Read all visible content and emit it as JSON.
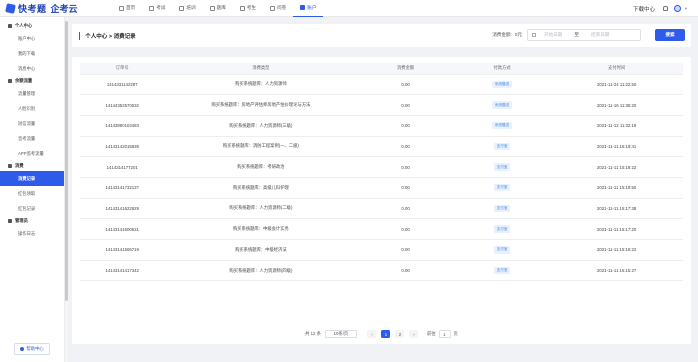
{
  "brand": {
    "name": "快考题",
    "sub": "企考云"
  },
  "nav": [
    {
      "label": "首页",
      "icon": "home-icon"
    },
    {
      "label": "考试",
      "icon": "exam-icon"
    },
    {
      "label": "培训",
      "icon": "training-icon"
    },
    {
      "label": "题库",
      "icon": "question-bank-icon"
    },
    {
      "label": "考生",
      "icon": "examinee-icon"
    },
    {
      "label": "问卷",
      "icon": "survey-icon"
    },
    {
      "label": "账户",
      "icon": "account-icon",
      "active": true
    }
  ],
  "topright": {
    "download": "下载中心"
  },
  "sidebar": {
    "groups": [
      {
        "title": "个人中心",
        "items": [
          "账户中心",
          "我的下载",
          "消息中心"
        ]
      },
      {
        "title": "余额流量",
        "items": [
          "流量管理",
          "人脸识别",
          "短信流量",
          "音考流量",
          "APP监考流量"
        ]
      },
      {
        "title": "消费",
        "items": [
          "消费记录",
          "红包领取",
          "红包记录"
        ]
      },
      {
        "title": "管理员",
        "items": [
          "操作日志"
        ]
      }
    ],
    "active": "消费记录",
    "help": "帮助中心"
  },
  "header": {
    "breadcrumb": "个人中心 > 消费记录",
    "amount_label": "消费金额:",
    "amount_value": "0元",
    "start_placeholder": "开始日期",
    "to": "至",
    "end_placeholder": "结束日期",
    "search": "搜索"
  },
  "table": {
    "columns": [
      "订单号",
      "消费类型",
      "消费金额",
      "付款方式",
      "支付时间"
    ],
    "rows": [
      [
        "1414331142287",
        "购买系统题库：人力资源师",
        "0.00",
        "系统赠送",
        "2021-11-24 11:22:50"
      ],
      [
        "14144352570632",
        "购买系统题库：房地产评估师房地产估价理论与方法",
        "0.00",
        "系统赠送",
        "2021-11-16 11:35:20"
      ],
      [
        "14143880103483",
        "购买系统题库：人力资源师(三级)",
        "0.00",
        "系统赠送",
        "2021-11-12 11:32:19"
      ],
      [
        "14143142015839",
        "购买系统题库：消防工程案例(一、二级)",
        "0.00",
        "支付宝",
        "2021-11-11 15:19:41"
      ],
      [
        "1414314177201",
        "购买系统题库：考研政治",
        "0.00",
        "支付宝",
        "2021-11-11 15:19:22"
      ],
      [
        "1414314173213?",
        "购买系统题库：高级儿科护理",
        "0.00",
        "支付宝",
        "2021-11-11 15:18:50"
      ],
      [
        "14143141622929",
        "购买系统题库：人力资源师(二级)",
        "0.00",
        "支付宝",
        "2021-11-11 15:17:38"
      ],
      [
        "14143141600631",
        "购买系统题库：中级会计实务",
        "0.00",
        "支付宝",
        "2021-11-11 15:17:20"
      ],
      [
        "14143141506719",
        "购买系统题库：中级经济法",
        "0.00",
        "支付宝",
        "2021-11-11 15:16:22"
      ],
      [
        "14143141417342",
        "购买系统题库：人力资源师(四级)",
        "0.00",
        "支付宝",
        "2021-11-11 15:15:27"
      ]
    ]
  },
  "pager": {
    "total": "共 12 条",
    "page_size": "10条/页",
    "prev": "‹",
    "pages": [
      "1",
      "2"
    ],
    "current": "1",
    "next": "›",
    "goto_label": "前往",
    "goto_value": "1",
    "goto_suffix": "页"
  }
}
